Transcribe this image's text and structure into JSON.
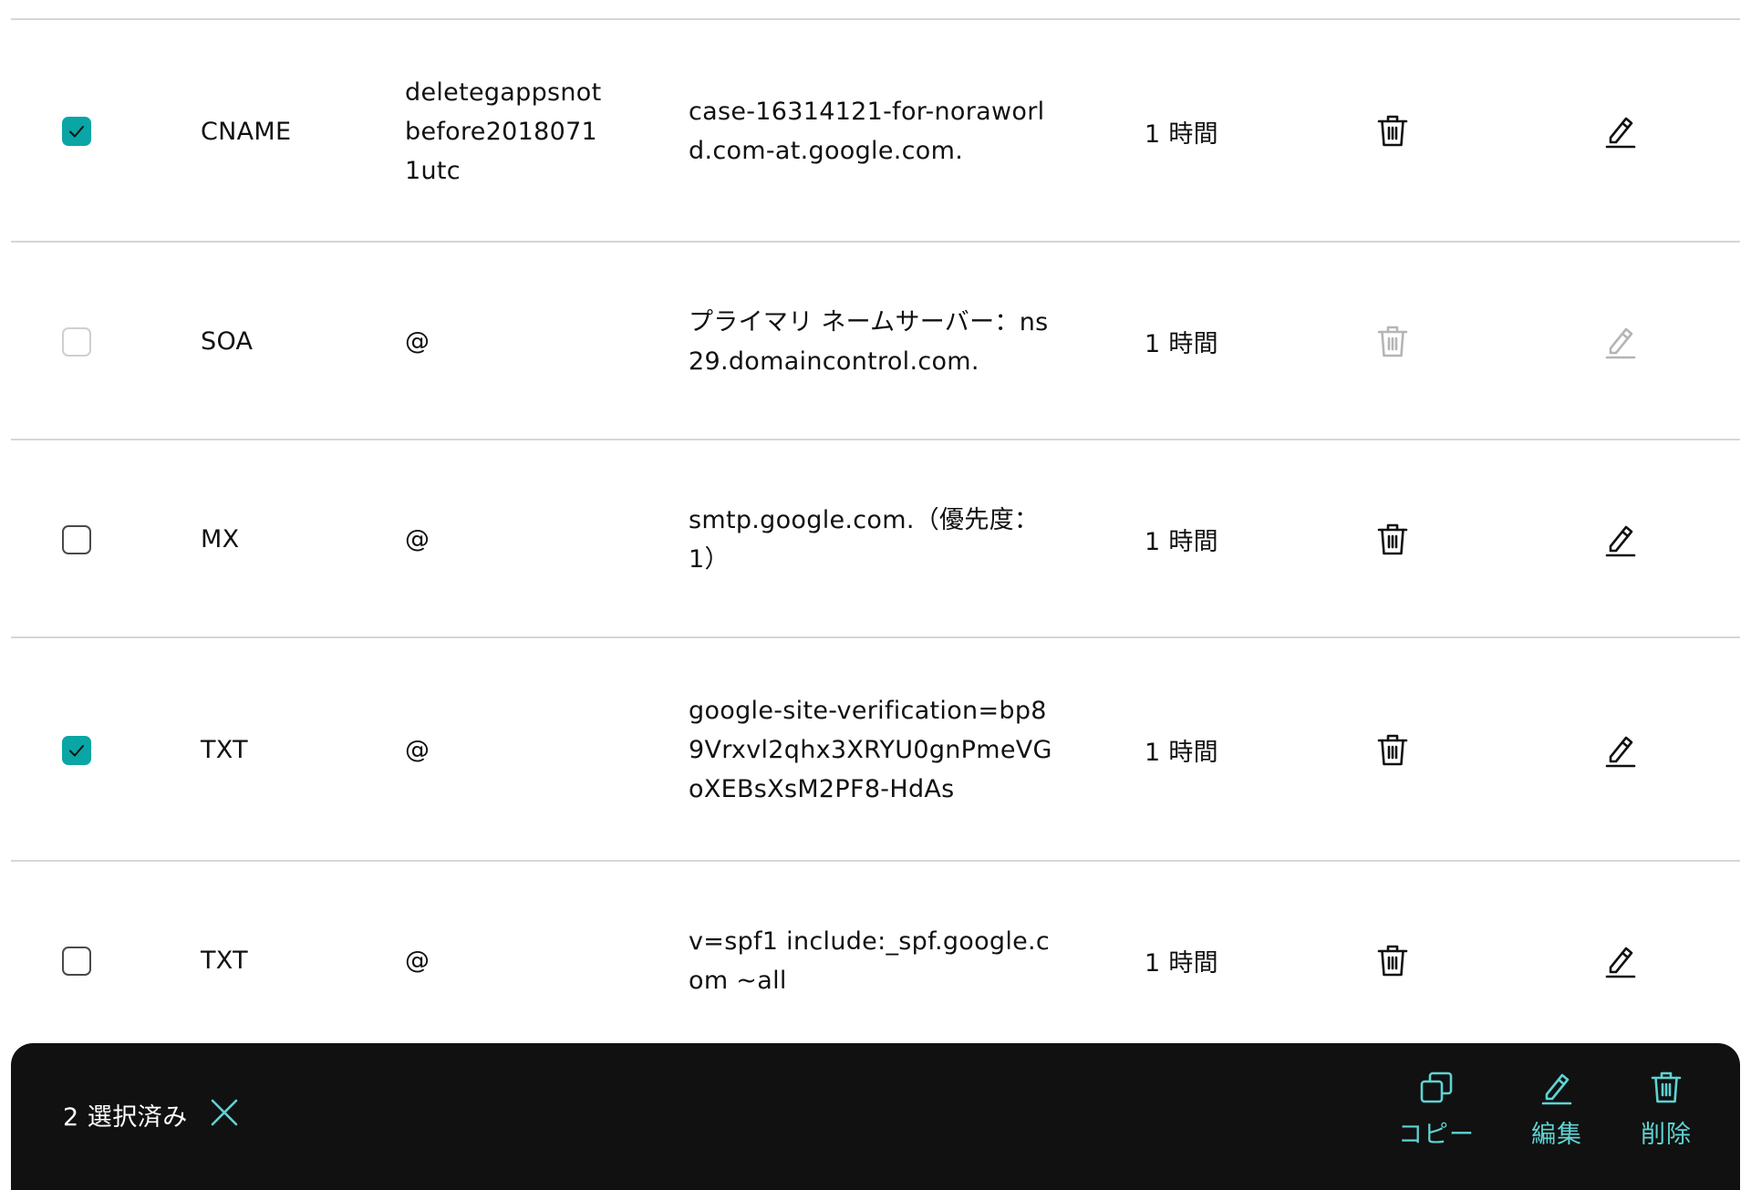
{
  "records": [
    {
      "type": "CNAME",
      "name": "deletegappsnotbefore20180711utc",
      "value": "case-16314121-for-noraworld.com-at.google.com.",
      "ttl": "1 時間",
      "checked": true,
      "editable": true
    },
    {
      "type": "SOA",
      "name": "@",
      "value": "プライマリ ネームサーバー：ns29.domaincontrol.com.",
      "ttl": "1 時間",
      "checked": false,
      "editable": false
    },
    {
      "type": "MX",
      "name": "@",
      "value": "smtp.google.com.（優先度：1）",
      "ttl": "1 時間",
      "checked": false,
      "editable": true
    },
    {
      "type": "TXT",
      "name": "@",
      "value": "google-site-verification=bp89Vrxvl2qhx3XRYU0gnPmeVGoXEBsXsM2PF8-HdAs",
      "ttl": "1 時間",
      "checked": true,
      "editable": true
    },
    {
      "type": "TXT",
      "name": "@",
      "value": "v=spf1 include:_spf.google.com ~all",
      "ttl": "1 時間",
      "checked": false,
      "editable": true
    }
  ],
  "selection_bar": {
    "count_label": "2 選択済み",
    "copy_label": "コピー",
    "edit_label": "編集",
    "delete_label": "削除"
  },
  "colors": {
    "accent": "#0aa5a5",
    "action_text": "#5fd3d3",
    "bar_background": "#111111",
    "divider": "#d6d6d6",
    "disabled_icon": "#b5b5b5"
  },
  "icons": {
    "row_delete": "trash-icon",
    "row_edit": "pencil-icon",
    "close": "close-icon",
    "copy": "copy-icon",
    "check": "check-icon"
  }
}
